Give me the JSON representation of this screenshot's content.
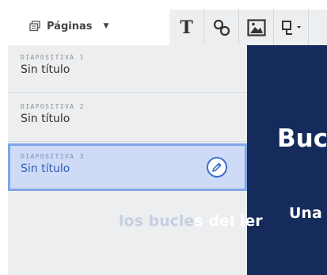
{
  "toolbar": {
    "pages_label": "Páginas",
    "pages_icon": "pages-icon",
    "tools": [
      {
        "name": "text-tool",
        "glyph": "T"
      },
      {
        "name": "shape-link-tool",
        "icon": "link-icon"
      },
      {
        "name": "image-tool",
        "icon": "image-icon"
      },
      {
        "name": "shape-tool",
        "icon": "shape-icon"
      }
    ]
  },
  "slides": [
    {
      "label": "DIAPOSITIVA 1",
      "title": "Sin título",
      "selected": false
    },
    {
      "label": "DIAPOSITIVA 2",
      "title": "Sin título",
      "selected": false
    },
    {
      "label": "DIAPOSITIVA 3",
      "title": "Sin título",
      "selected": true
    }
  ],
  "preview": {
    "heading": "Buc",
    "sub_line1": "Una",
    "sub_line2_faded": "los bucle",
    "sub_line2_solid": "s del ler"
  },
  "colors": {
    "accent": "#3d6fd0",
    "selected_bg": "#cfdaf7",
    "preview_bg": "#142b5b",
    "panel_bg": "#eceeef"
  }
}
